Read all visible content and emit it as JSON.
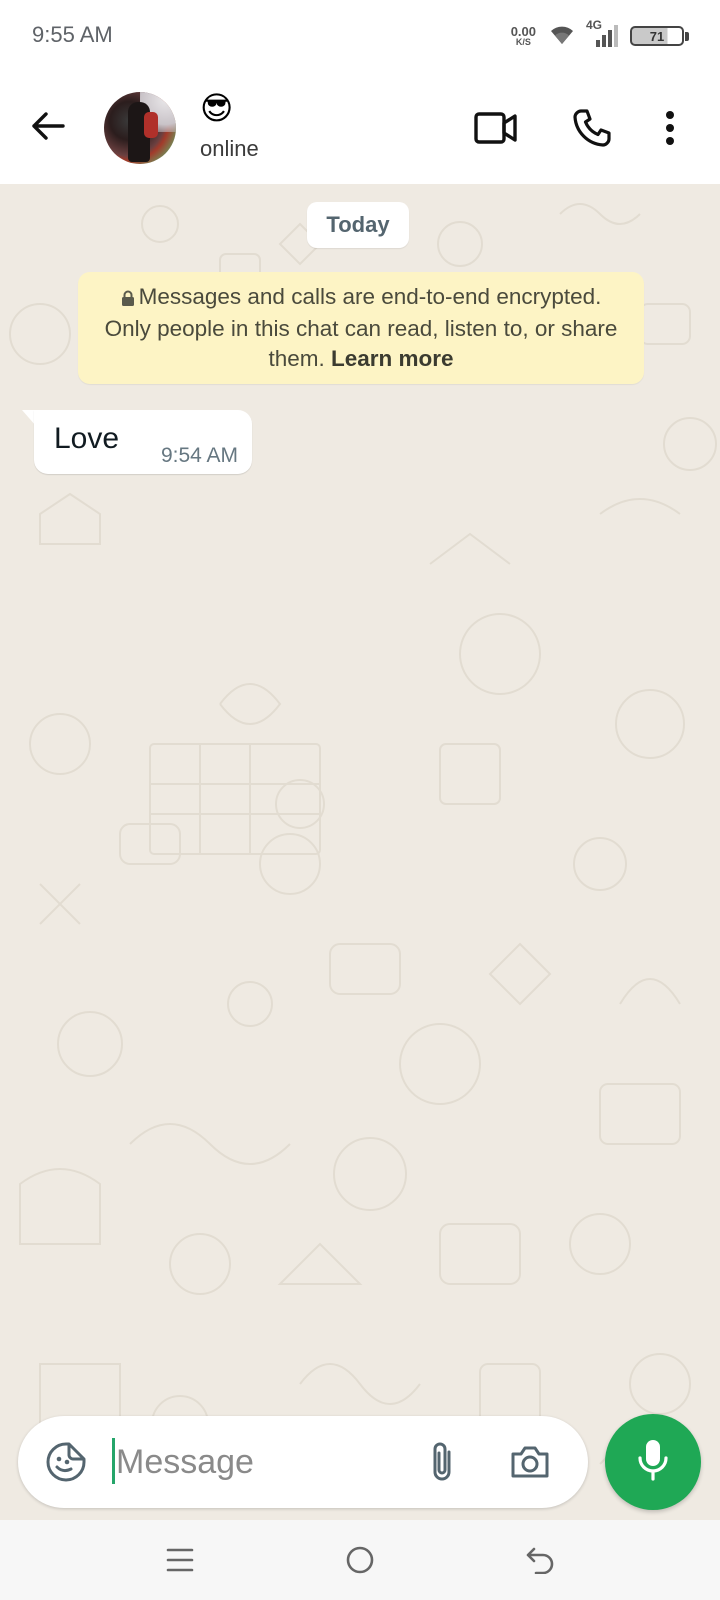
{
  "status_bar": {
    "time": "9:55 AM",
    "net_speed": "0.00",
    "net_speed_unit": "K/S",
    "network": "4G",
    "battery": "71",
    "battery_level_percent": 71
  },
  "header": {
    "contact_name_emoji": "😎",
    "contact_status": "online",
    "icons": [
      "back-arrow-icon",
      "video-call-icon",
      "phone-icon",
      "more-options-icon"
    ]
  },
  "chat": {
    "date_label": "Today",
    "encryption_notice": {
      "text": "Messages and calls are end-to-end encrypted. Only people in this chat can read, listen to, or share them.",
      "link": "Learn more"
    },
    "messages": [
      {
        "direction": "incoming",
        "text": "Love",
        "time": "9:54 AM"
      }
    ],
    "background_color": "#efeae2"
  },
  "composer": {
    "placeholder": "Message",
    "value": "",
    "icons": [
      "sticker-icon",
      "attach-icon",
      "camera-icon",
      "mic-icon"
    ],
    "accent_color": "#1fa855"
  },
  "nav_bar": {
    "icons": [
      "menu-icon",
      "home-icon",
      "back-icon"
    ]
  }
}
